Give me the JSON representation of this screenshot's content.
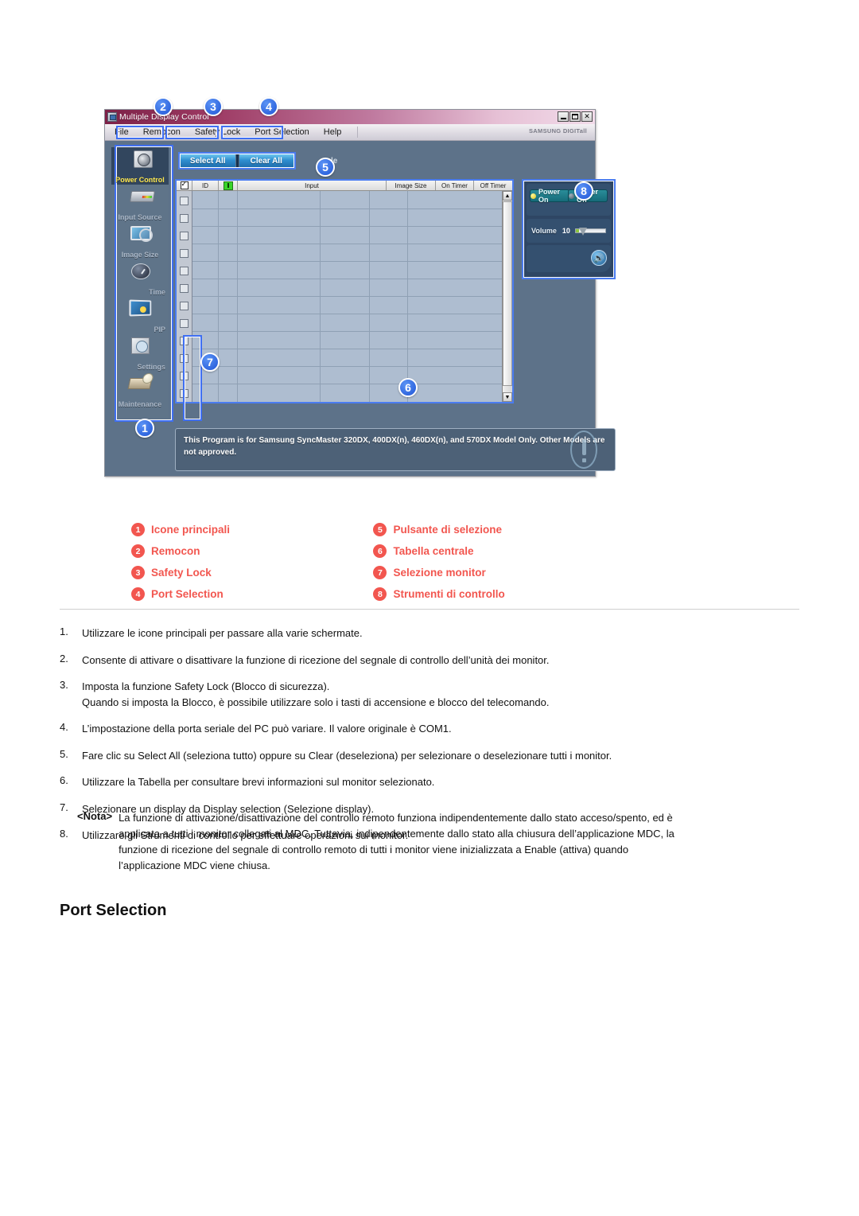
{
  "app": {
    "title": "Multiple Display Control",
    "window_buttons": [
      "minimize",
      "maximize",
      "close"
    ],
    "brand": "SAMSUNG DIGITall",
    "menu": [
      "File",
      "Remocon",
      "Safety Lock",
      "Port Selection",
      "Help"
    ],
    "sidebar": {
      "items": [
        {
          "label": "Power Control",
          "icon": "power-control-icon",
          "active": true
        },
        {
          "label": "Input Source",
          "icon": "input-source-icon",
          "active": false
        },
        {
          "label": "Image Size",
          "icon": "image-size-icon",
          "active": false
        },
        {
          "label": "Time",
          "icon": "time-icon",
          "active": false
        },
        {
          "label": "PIP",
          "icon": "pip-icon",
          "active": false
        },
        {
          "label": "Settings",
          "icon": "settings-icon",
          "active": false
        },
        {
          "label": "Maintenance",
          "icon": "maintenance-icon",
          "active": false
        }
      ]
    },
    "toolbar": {
      "select_all": "Select All",
      "clear_all": "Clear All",
      "enable_label": "le"
    },
    "table": {
      "headers": [
        "",
        "ID",
        "",
        "Input",
        "Image Size",
        "On Timer",
        "Off Timer"
      ],
      "header_checkbox_icon": "checked-checkbox-icon",
      "header_power_icon": "power-status-icon",
      "rows": [],
      "empty_row_count": 12
    },
    "controls": {
      "power_on": "Power On",
      "power_off": "Power Off",
      "volume_label": "Volume",
      "volume_value": "10",
      "volume_percent": 12,
      "speaker_icon": "speaker-icon"
    },
    "footer_note": "This Program is for Samsung SyncMaster 320DX, 400DX(n), 460DX(n), and 570DX  Model Only. Other Models are not approved.",
    "badges": [
      "1",
      "2",
      "3",
      "4",
      "5",
      "6",
      "7",
      "8"
    ]
  },
  "legend": {
    "left": [
      {
        "num": "1",
        "label": "Icone principali"
      },
      {
        "num": "2",
        "label": "Remocon"
      },
      {
        "num": "3",
        "label": "Safety Lock"
      },
      {
        "num": "4",
        "label": "Port Selection"
      }
    ],
    "right": [
      {
        "num": "5",
        "label": "Pulsante di selezione"
      },
      {
        "num": "6",
        "label": "Tabella centrale"
      },
      {
        "num": "7",
        "label": "Selezione monitor"
      },
      {
        "num": "8",
        "label": "Strumenti di controllo"
      }
    ]
  },
  "instructions": [
    {
      "num": "1.",
      "line1": "Utilizzare le icone principali per passare alla varie schermate.",
      "line2": ""
    },
    {
      "num": "2.",
      "line1": "Consente di attivare o disattivare la funzione di ricezione del segnale di controllo dell’unità dei monitor.",
      "line2": ""
    },
    {
      "num": "3.",
      "line1": "Imposta la funzione Safety Lock (Blocco di sicurezza).",
      "line2": "Quando si imposta la Blocco, è possibile utilizzare solo i tasti di accensione e blocco del telecomando."
    },
    {
      "num": "4.",
      "line1": "L’impostazione della porta seriale del PC può variare. Il valore originale è COM1.",
      "line2": ""
    },
    {
      "num": "5.",
      "line1": "Fare clic su Select All (seleziona tutto) oppure su Clear (deseleziona) per selezionare o deselezionare tutti i monitor.",
      "line2": ""
    },
    {
      "num": "6.",
      "line1": "Utilizzare la Tabella per consultare brevi informazioni sul monitor selezionato.",
      "line2": ""
    },
    {
      "num": "7.",
      "line1": "Selezionare un display da Display selection (Selezione display).",
      "line2": ""
    },
    {
      "num": "8.",
      "line1": "Utilizzare gli Strumenti di controllo per effettuare operazioni sui monitor.",
      "line2": ""
    }
  ],
  "nota": {
    "tag": "<Nota>",
    "text": "La funzione di attivazione/disattivazione del controllo remoto funziona indipendentemente dallo stato acceso/spento, ed è applicata a tutti i monitor collegati al MDC. Tuttavia, indipendentemente dallo stato alla chiusura dell’applicazione MDC, la funzione di ricezione del segnale di controllo remoto di tutti i monitor viene inizializzata a Enable (attiva) quando l’applicazione MDC viene chiusa."
  },
  "section_heading": "Port Selection",
  "colors": {
    "accent_red": "#f2564f",
    "badge_blue": "#2b5fe8",
    "app_bg": "#5d7289",
    "panel_dark": "#2e4664",
    "active_yellow": "#ffe84f"
  }
}
